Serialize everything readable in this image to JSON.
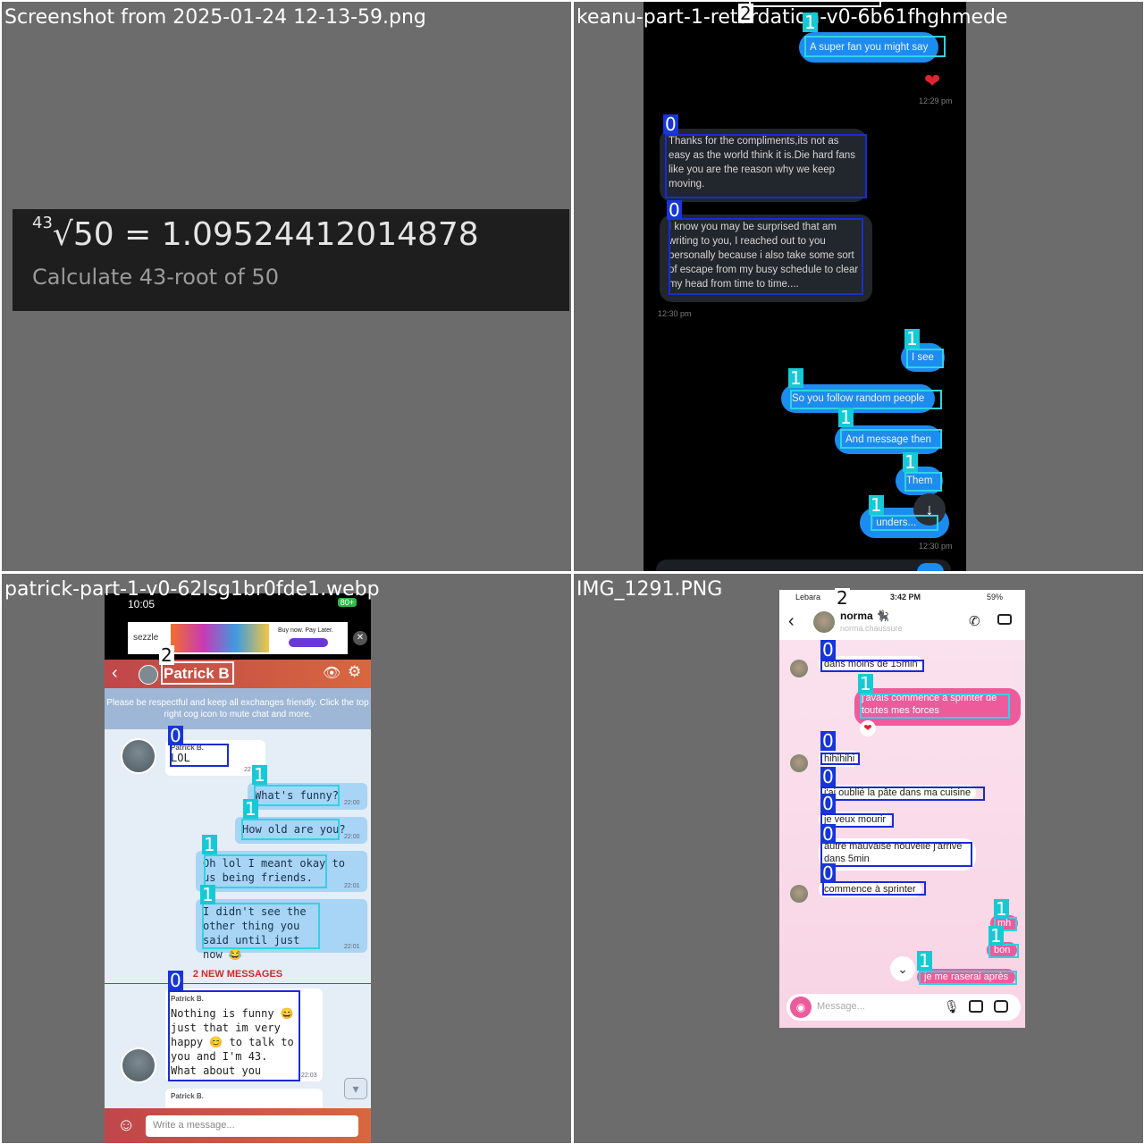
{
  "panels": [
    {
      "filename": "Screenshot from 2025-01-24 12-13-59.png",
      "calc": {
        "index": "43",
        "equation": "√50 = 1.09524412014878",
        "description": "Calculate 43-root of 50"
      }
    },
    {
      "filename": "keanu-part-1-retardation-v0-6b61fhghmede",
      "messages": [
        {
          "text": "A super fan you might say",
          "label": "1"
        },
        {
          "text": "Thanks for the compliments,its not as easy as the world think it is.Die hard fans like you are the reason why we keep moving.",
          "label": "0"
        },
        {
          "text": "I know you may be surprised that am writing to you, I reached out to you personally because i also take some sort of escape from my busy schedule to clear my head from time to time....",
          "label": "0"
        },
        {
          "text": "I see",
          "label": "1"
        },
        {
          "text": "So you follow random people",
          "label": "1"
        },
        {
          "text": "And message then",
          "label": "1"
        },
        {
          "text": "Them",
          "label": "1"
        },
        {
          "text": "I unders...",
          "label": "1"
        }
      ],
      "times": [
        "12:29 pm",
        "12:30 pm",
        "12:30 pm"
      ],
      "top_label": "2",
      "reaction": "heart-icon"
    },
    {
      "filename": "patrick-part-1-v0-62lsg1br0fde1.webp",
      "status_time": "10:05",
      "battery": "80+",
      "ad_brand": "sezzle",
      "ad_text": "Buy now. Pay Later.",
      "contact": "Patrick B",
      "contact_label": "2",
      "notice": "Please be respectful and keep all exchanges friendly. Click the top right cog icon to mute chat and more.",
      "messages": [
        {
          "sender": "Patrick B.",
          "text": "LOL",
          "time": "22",
          "label": "0"
        },
        {
          "text": "What's funny?",
          "time": "22:00",
          "label": "1"
        },
        {
          "text": "How old are you?",
          "time": "22:00",
          "label": "1"
        },
        {
          "text": "Oh lol I meant okay to us being friends.",
          "time": "22:01",
          "label": "1"
        },
        {
          "text": "I didn't see the other thing you said until just now 😂",
          "time": "22:01",
          "label": "1"
        },
        {
          "sender": "Patrick B.",
          "text": "Nothing is funny 😄 just that im very happy 😊 to talk to you and I'm 43. What about you",
          "time": "22:03",
          "label": "0"
        },
        {
          "sender": "Patrick B.",
          "text": "",
          "time": "",
          "label": ""
        }
      ],
      "new_messages": "2 NEW MESSAGES",
      "input_placeholder": "Write a message..."
    },
    {
      "filename": "IMG_1291.PNG",
      "carrier": "Lebara",
      "time": "3:42 PM",
      "battery": "59%",
      "contact": "norma 🐈‍⬛",
      "contact_sub": "norma.chaussure",
      "contact_label": "2",
      "messages": [
        {
          "text": "dans moins de 15min",
          "label": "0"
        },
        {
          "text": "j'avais commencé à sprinter de toutes mes forces",
          "label": "1"
        },
        {
          "text": "hihihihi",
          "label": "0"
        },
        {
          "text": "j'ai oublié la pâte dans ma cuisine",
          "label": "0"
        },
        {
          "text": "je veux mourir",
          "label": "0"
        },
        {
          "text": "autre mauvaise nouvelle j'arrive dans 5min",
          "label": "0"
        },
        {
          "text": "commence à sprinter",
          "label": "0"
        },
        {
          "text": "mh",
          "label": "1"
        },
        {
          "text": "bon",
          "label": "1"
        },
        {
          "text": "je me raserai après",
          "label": "1"
        }
      ],
      "input_placeholder": "Message..."
    }
  ]
}
